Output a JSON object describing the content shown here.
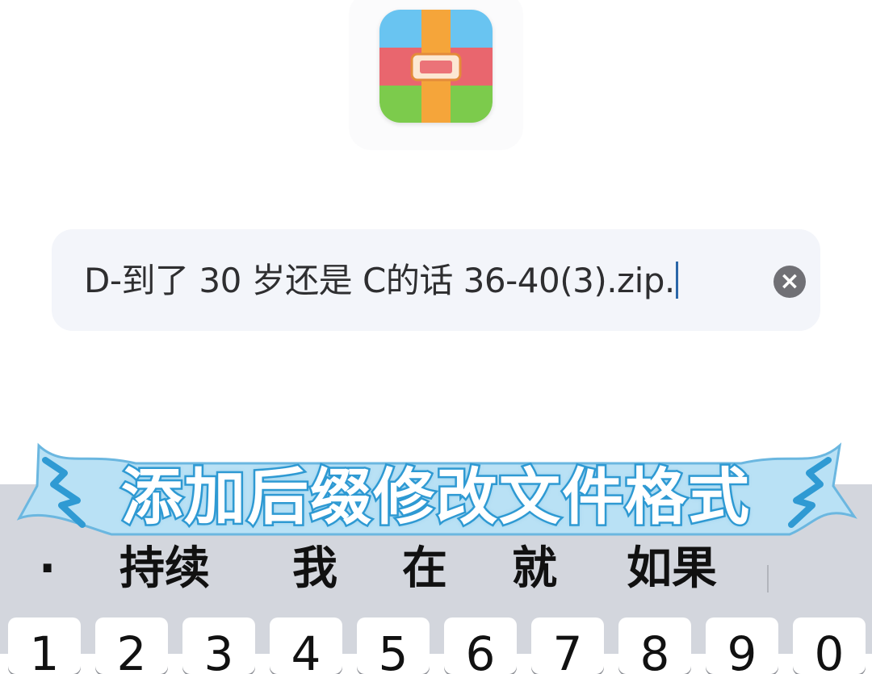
{
  "app_icon": {
    "icon": "archive-zip-icon",
    "colors": {
      "blue": "#69C4F1",
      "red": "#E9666E",
      "green": "#7CCB4C",
      "strap": "#F5A53A"
    }
  },
  "filename_field": {
    "value": "D-到了 30 岁还是 C的话 36-40(3).zip.",
    "clear_icon": "clear-x-icon"
  },
  "caption": {
    "text": "添加后缀修改文件格式",
    "fill_color": "#FFFFFF",
    "stroke_color": "#2F9AD3",
    "banner_color": "#B9E1F5"
  },
  "keyboard": {
    "suggestions": [
      "·",
      "持续",
      "我",
      "在",
      "就",
      "如果"
    ],
    "number_keys": [
      "1",
      "2",
      "3",
      "4",
      "5",
      "6",
      "7",
      "8",
      "9",
      "0"
    ]
  }
}
